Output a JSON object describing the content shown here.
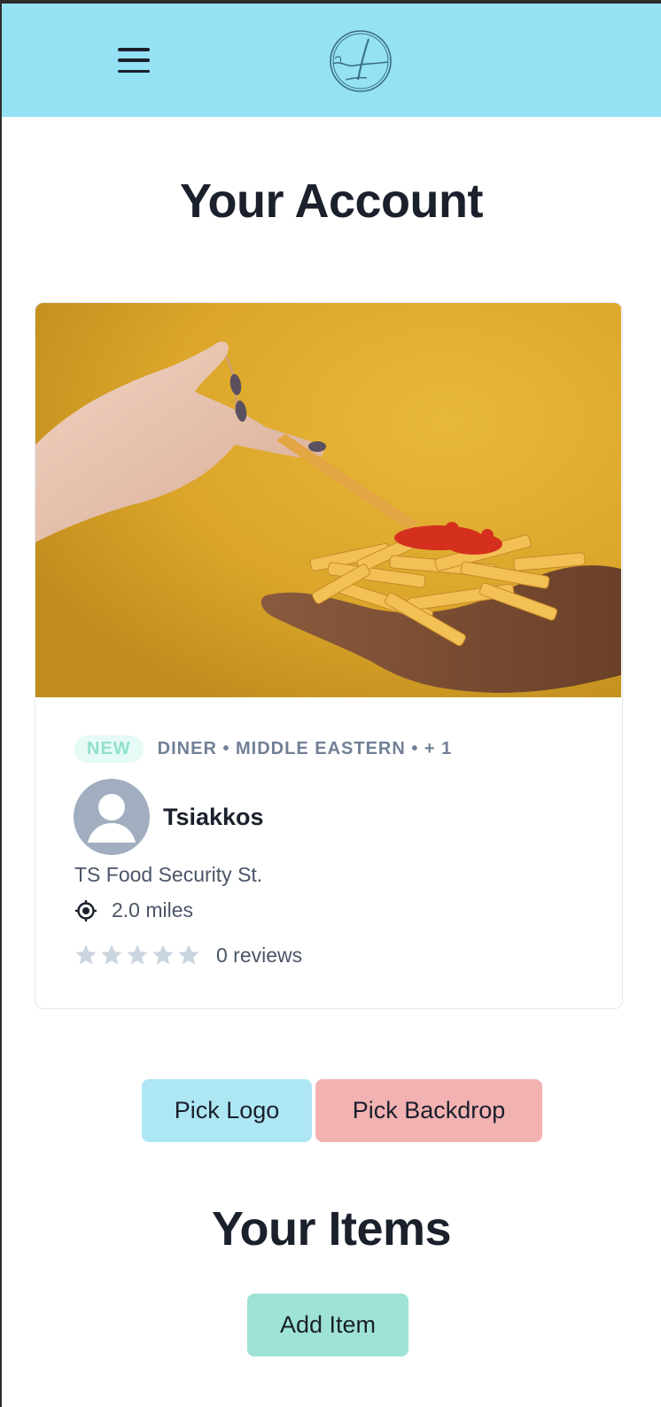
{
  "header": {
    "menu_icon": "hamburger-menu-icon",
    "logo_icon": "brand-logo-icon",
    "background_color": "#94e2f4"
  },
  "account": {
    "title": "Your Account"
  },
  "card": {
    "hero_image": "french-fries-with-ketchup-photo",
    "badge": "NEW",
    "categories": "DINER • MIDDLE EASTERN • + 1",
    "name": "Tsiakkos",
    "address": "TS Food Security St.",
    "distance": "2.0 miles",
    "rating": 0,
    "max_rating": 5,
    "reviews": "0 reviews"
  },
  "buttons": {
    "pick_logo": "Pick Logo",
    "pick_backdrop": "Pick Backdrop",
    "add_item": "Add Item"
  },
  "items": {
    "title": "Your Items"
  },
  "colors": {
    "header_bg": "#94e2f4",
    "pick_logo_bg": "#aee7f4",
    "pick_backdrop_bg": "#f2b2b2",
    "add_item_bg": "#9ee3d5",
    "badge_bg": "#e6faf6",
    "badge_text": "#8fe0cb"
  }
}
